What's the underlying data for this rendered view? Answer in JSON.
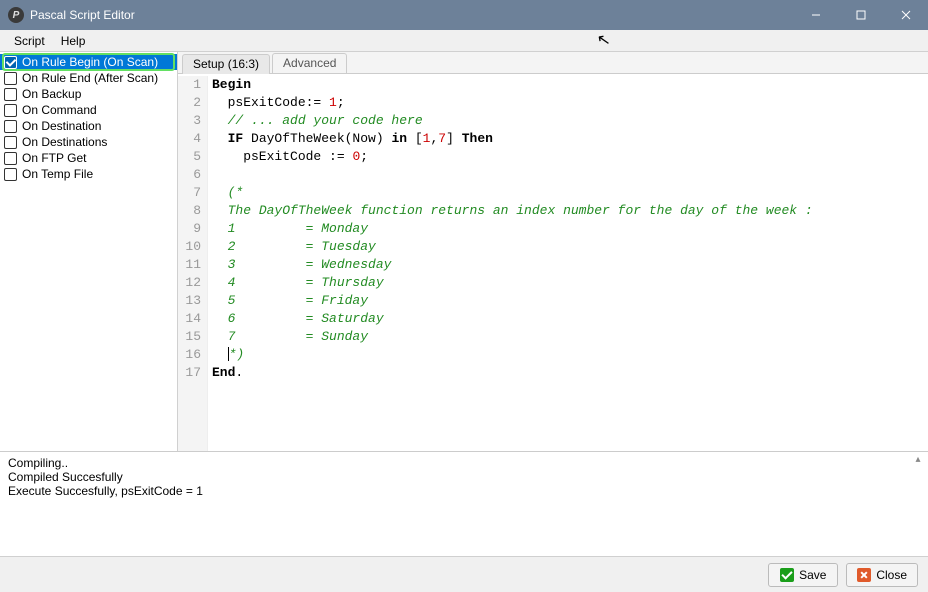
{
  "window": {
    "title": "Pascal Script Editor"
  },
  "menu": {
    "items": [
      "Script",
      "Help"
    ]
  },
  "sidebar": {
    "items": [
      {
        "label": "On Rule Begin (On Scan)",
        "checked": true,
        "selected": true,
        "highlighted": true
      },
      {
        "label": "On Rule End (After Scan)",
        "checked": false,
        "selected": false,
        "highlighted": false
      },
      {
        "label": "On Backup",
        "checked": false,
        "selected": false,
        "highlighted": false
      },
      {
        "label": "On Command",
        "checked": false,
        "selected": false,
        "highlighted": false
      },
      {
        "label": "On Destination",
        "checked": false,
        "selected": false,
        "highlighted": false
      },
      {
        "label": "On Destinations",
        "checked": false,
        "selected": false,
        "highlighted": false
      },
      {
        "label": "On FTP Get",
        "checked": false,
        "selected": false,
        "highlighted": false
      },
      {
        "label": "On Temp File",
        "checked": false,
        "selected": false,
        "highlighted": false
      }
    ]
  },
  "tabs": {
    "items": [
      {
        "label": "Setup (16:3)",
        "active": true
      },
      {
        "label": "Advanced",
        "active": false
      }
    ]
  },
  "code": {
    "lines": [
      {
        "n": 1,
        "segs": [
          {
            "t": "Begin",
            "c": "kw"
          }
        ]
      },
      {
        "n": 2,
        "segs": [
          {
            "t": "  psExitCode:= "
          },
          {
            "t": "1",
            "c": "num"
          },
          {
            "t": ";"
          }
        ]
      },
      {
        "n": 3,
        "segs": [
          {
            "t": "  "
          },
          {
            "t": "// ... add your code here",
            "c": "cm"
          }
        ]
      },
      {
        "n": 4,
        "segs": [
          {
            "t": "  "
          },
          {
            "t": "IF",
            "c": "kw"
          },
          {
            "t": " DayOfTheWeek(Now) "
          },
          {
            "t": "in",
            "c": "kw"
          },
          {
            "t": " ["
          },
          {
            "t": "1",
            "c": "num"
          },
          {
            "t": ","
          },
          {
            "t": "7",
            "c": "num"
          },
          {
            "t": "] "
          },
          {
            "t": "Then",
            "c": "kw"
          }
        ]
      },
      {
        "n": 5,
        "segs": [
          {
            "t": "    psExitCode := "
          },
          {
            "t": "0",
            "c": "num"
          },
          {
            "t": ";"
          }
        ]
      },
      {
        "n": 6,
        "segs": [
          {
            "t": " "
          }
        ]
      },
      {
        "n": 7,
        "segs": [
          {
            "t": "  "
          },
          {
            "t": "(*",
            "c": "cm"
          }
        ]
      },
      {
        "n": 8,
        "segs": [
          {
            "t": "  "
          },
          {
            "t": "The DayOfTheWeek function returns an index number for the day of the week :",
            "c": "cm"
          }
        ]
      },
      {
        "n": 9,
        "segs": [
          {
            "t": "  "
          },
          {
            "t": "1         = Monday",
            "c": "cm"
          }
        ]
      },
      {
        "n": 10,
        "segs": [
          {
            "t": "  "
          },
          {
            "t": "2         = Tuesday",
            "c": "cm"
          }
        ]
      },
      {
        "n": 11,
        "segs": [
          {
            "t": "  "
          },
          {
            "t": "3         = Wednesday",
            "c": "cm"
          }
        ]
      },
      {
        "n": 12,
        "segs": [
          {
            "t": "  "
          },
          {
            "t": "4         = Thursday",
            "c": "cm"
          }
        ]
      },
      {
        "n": 13,
        "segs": [
          {
            "t": "  "
          },
          {
            "t": "5         = Friday",
            "c": "cm"
          }
        ]
      },
      {
        "n": 14,
        "segs": [
          {
            "t": "  "
          },
          {
            "t": "6         = Saturday",
            "c": "cm"
          }
        ]
      },
      {
        "n": 15,
        "segs": [
          {
            "t": "  "
          },
          {
            "t": "7         = Sunday",
            "c": "cm"
          }
        ]
      },
      {
        "n": 16,
        "segs": [
          {
            "t": "  "
          },
          {
            "caret": true
          },
          {
            "t": "*)",
            "c": "cm"
          }
        ]
      },
      {
        "n": 17,
        "segs": [
          {
            "t": "End",
            "c": "kw"
          },
          {
            "t": "."
          }
        ]
      }
    ]
  },
  "output": {
    "lines": [
      "Compiling..",
      "Compiled Succesfully",
      "Execute Succesfully, psExitCode = 1"
    ]
  },
  "bottom": {
    "save": "Save",
    "close": "Close"
  }
}
